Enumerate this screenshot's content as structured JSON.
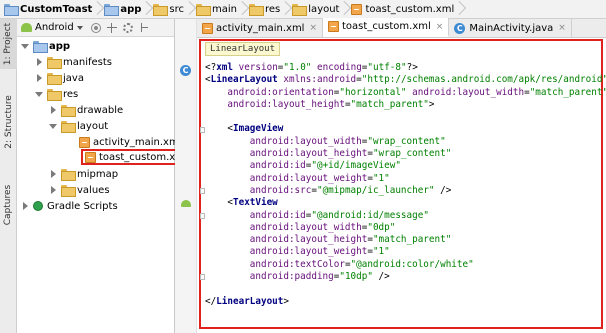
{
  "breadcrumb": [
    "CustomToast",
    "app",
    "src",
    "main",
    "res",
    "layout",
    "toast_custom.xml"
  ],
  "side_tabs": [
    "1: Project",
    "2: Structure",
    "Captures"
  ],
  "project_panel": {
    "view_label": "Android",
    "tree": [
      {
        "label": "app"
      },
      {
        "label": "manifests"
      },
      {
        "label": "java"
      },
      {
        "label": "res"
      },
      {
        "label": "drawable"
      },
      {
        "label": "layout"
      },
      {
        "label": "activity_main.xml"
      },
      {
        "label": "toast_custom.xml"
      },
      {
        "label": "mipmap"
      },
      {
        "label": "values"
      },
      {
        "label": "Gradle Scripts"
      }
    ]
  },
  "tabs": [
    {
      "label": "activity_main.xml",
      "close": "×"
    },
    {
      "label": "toast_custom.xml",
      "close": "×"
    },
    {
      "label": "MainActivity.java",
      "close": "×"
    }
  ],
  "java_icon_letter": "C",
  "editor": {
    "breadcrumb_tag": "LinearLayout",
    "lines": [
      "<?xml version=\"1.0\" encoding=\"utf-8\"?>",
      "<LinearLayout xmlns:android=\"http://schemas.android.com/apk/res/android\"",
      "    android:orientation=\"horizontal\" android:layout_width=\"match_parent\"",
      "    android:layout_height=\"match_parent\">",
      "",
      "    <ImageView",
      "        android:layout_width=\"wrap_content\"",
      "        android:layout_height=\"wrap_content\"",
      "        android:id=\"@+id/imageView\"",
      "        android:layout_weight=\"1\"",
      "        android:src=\"@mipmap/ic_launcher\" />",
      "    <TextView",
      "        android:id=\"@android:id/message\"",
      "        android:layout_width=\"0dp\"",
      "        android:layout_height=\"match_parent\"",
      "        android:layout_weight=\"1\"",
      "        android:textColor=\"@android:color/white\"",
      "        android:padding=\"10dp\" />",
      "",
      "</LinearLayout>"
    ]
  },
  "colors": {
    "highlight_border": "#e0221e",
    "tag": "#000080",
    "attr": "#660e7a",
    "value": "#008000"
  }
}
